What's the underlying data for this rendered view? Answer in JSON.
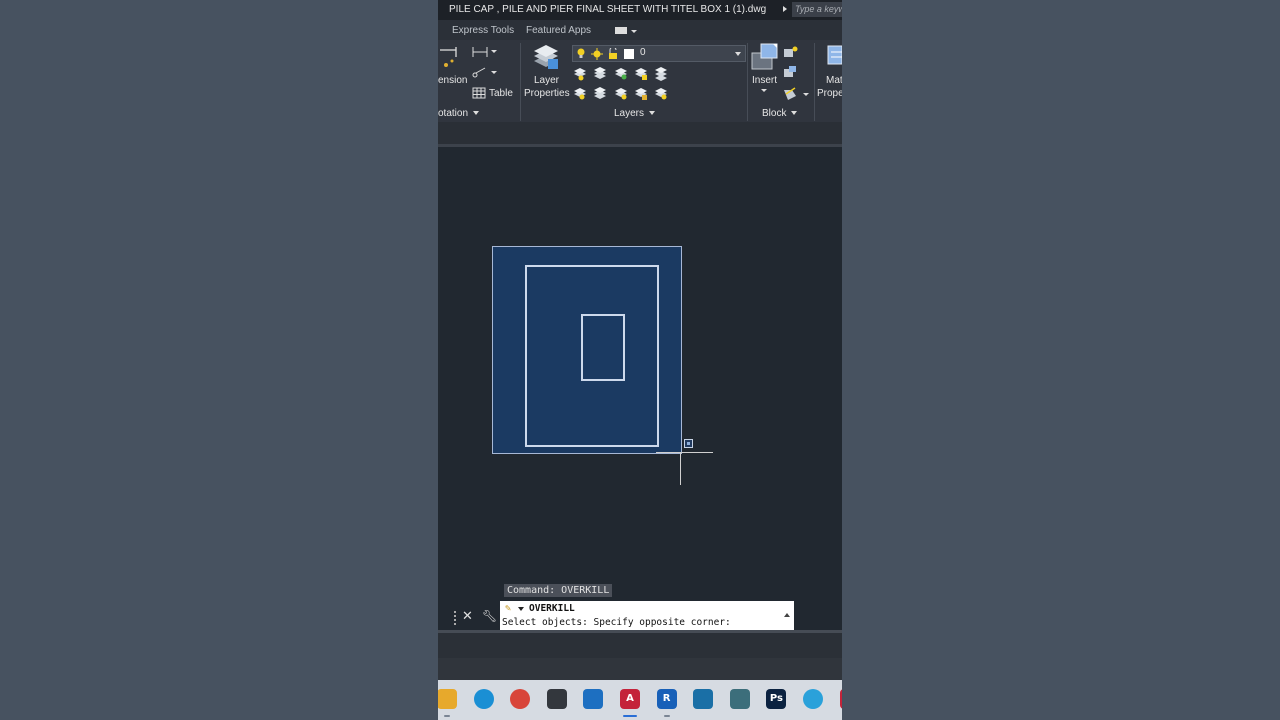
{
  "title_bar": {
    "title": "PILE CAP , PILE AND PIER FINAL SHEET WITH TITEL BOX 1 (1).dwg",
    "search_placeholder": "Type a keyword"
  },
  "ribbon_tabs": [
    "Express Tools",
    "Featured Apps"
  ],
  "ribbon": {
    "annotation_panel": {
      "dimension_label": "ension",
      "table_label": "Table",
      "panel_label": "otation"
    },
    "layers_panel": {
      "layer_properties_line1": "Layer",
      "layer_properties_line2": "Properties",
      "current_layer": "0",
      "panel_label": "Layers"
    },
    "block_panel": {
      "insert_label": "Insert",
      "panel_label": "Block"
    },
    "properties_panel": {
      "match_line1": "Mat",
      "match_line2": "Prope"
    }
  },
  "command": {
    "history": "Command: OVERKILL",
    "current": "OVERKILL",
    "prompt": "Select objects: Specify opposite corner:"
  },
  "taskbar": {
    "apps": [
      {
        "icon": "file-explorer-icon",
        "color": "#e7a92c",
        "label": ""
      },
      {
        "icon": "edge-icon",
        "color": "#1a8fd4",
        "label": ""
      },
      {
        "icon": "chrome-icon",
        "color": "#d8453a",
        "label": ""
      },
      {
        "icon": "3d-app-icon",
        "color": "#33373d",
        "label": ""
      },
      {
        "icon": "store-icon",
        "color": "#1d6fc1",
        "label": ""
      },
      {
        "icon": "autocad-icon",
        "color": "#c4233a",
        "label": "A"
      },
      {
        "icon": "revit-icon",
        "color": "#1860b8",
        "label": "R"
      },
      {
        "icon": "sketchup-icon",
        "color": "#1a6fa6",
        "label": ""
      },
      {
        "icon": "structure-app-icon",
        "color": "#3c6e7b",
        "label": ""
      },
      {
        "icon": "photoshop-icon",
        "color": "#0b2240",
        "label": "Ps"
      },
      {
        "icon": "telegram-icon",
        "color": "#2aa1da",
        "label": ""
      },
      {
        "icon": "app-icon",
        "color": "#c4233a",
        "label": ""
      }
    ]
  },
  "colors": {
    "selection_fill": "#1b3a62",
    "drawing_lines": "#cdd9ec",
    "canvas_bg": "#212830"
  }
}
